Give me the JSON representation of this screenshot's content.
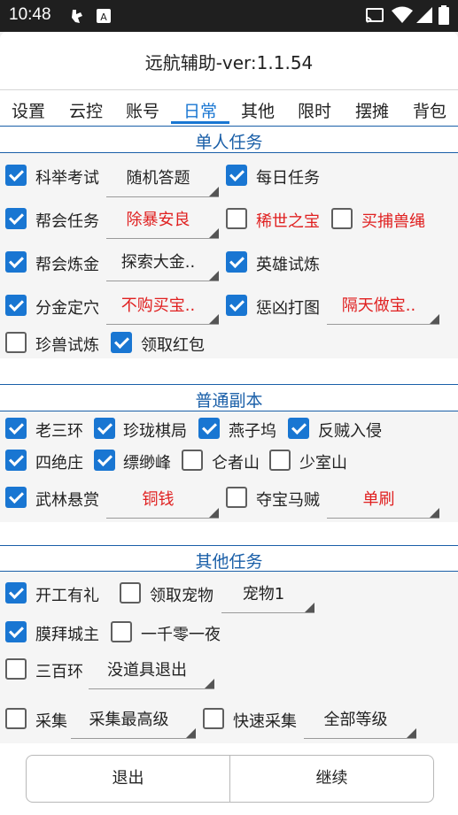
{
  "status": {
    "time": "10:48"
  },
  "app": {
    "title": "远航辅助-ver:1.1.54"
  },
  "tabs": [
    "设置",
    "云控",
    "账号",
    "日常",
    "其他",
    "限时",
    "摆摊",
    "背包"
  ],
  "active_tab": "日常",
  "sections": {
    "single": {
      "title": "单人任务"
    },
    "dungeon": {
      "title": "普通副本"
    },
    "other": {
      "title": "其他任务"
    }
  },
  "items": {
    "keju": {
      "label": "科举考试",
      "checked": true
    },
    "keju_dd": {
      "value": "随机答题"
    },
    "daily": {
      "label": "每日任务",
      "checked": true
    },
    "banghui_task": {
      "label": "帮会任务",
      "checked": true
    },
    "banghui_task_dd": {
      "value": "除暴安良"
    },
    "xishi": {
      "label": "稀世之宝",
      "checked": false
    },
    "maibu": {
      "label": "买捕兽绳",
      "checked": false
    },
    "banghui_lian": {
      "label": "帮会炼金",
      "checked": true
    },
    "banghui_lian_dd": {
      "value": "探索大金.."
    },
    "yingxiong": {
      "label": "英雄试炼",
      "checked": true
    },
    "fenjin": {
      "label": "分金定穴",
      "checked": true
    },
    "fenjin_dd": {
      "value": "不购买宝.."
    },
    "chengxiong": {
      "label": "惩凶打图",
      "checked": true
    },
    "chengxiong_dd": {
      "value": "隔天做宝.."
    },
    "zhenshou": {
      "label": "珍兽试炼",
      "checked": false
    },
    "hongbao": {
      "label": "领取红包",
      "checked": true
    },
    "laosan": {
      "label": "老三环",
      "checked": true
    },
    "zhenlong": {
      "label": "珍珑棋局",
      "checked": true
    },
    "yanzi": {
      "label": "燕子坞",
      "checked": true
    },
    "fanzei": {
      "label": "反贼入侵",
      "checked": true
    },
    "sijue": {
      "label": "四绝庄",
      "checked": true
    },
    "piaomiao": {
      "label": "缥缈峰",
      "checked": true
    },
    "lunzhe": {
      "label": "仑者山",
      "checked": false
    },
    "shaoshi": {
      "label": "少室山",
      "checked": false
    },
    "wulin": {
      "label": "武林悬赏",
      "checked": true
    },
    "wulin_dd": {
      "value": "铜钱"
    },
    "duobao": {
      "label": "夺宝马贼",
      "checked": false
    },
    "duobao_dd": {
      "value": "单刷"
    },
    "kaigong": {
      "label": "开工有礼",
      "checked": true
    },
    "chongwu": {
      "label": "领取宠物",
      "checked": false
    },
    "chongwu_dd": {
      "value": "宠物1"
    },
    "mobai": {
      "label": "膜拜城主",
      "checked": true
    },
    "yiqian": {
      "label": "一千零一夜",
      "checked": false
    },
    "sanbai": {
      "label": "三百环",
      "checked": false
    },
    "sanbai_dd": {
      "value": "没道具退出"
    },
    "caiji": {
      "label": "采集",
      "checked": false
    },
    "caiji_dd": {
      "value": "采集最高级"
    },
    "kuaisu": {
      "label": "快速采集",
      "checked": false
    },
    "kuaisu_dd": {
      "value": "全部等级"
    }
  },
  "buttons": {
    "exit": "退出",
    "continue": "继续"
  },
  "colors": {
    "accent": "#1976d2",
    "section": "#1a5fa8",
    "dropdown_value": "#e02020"
  }
}
